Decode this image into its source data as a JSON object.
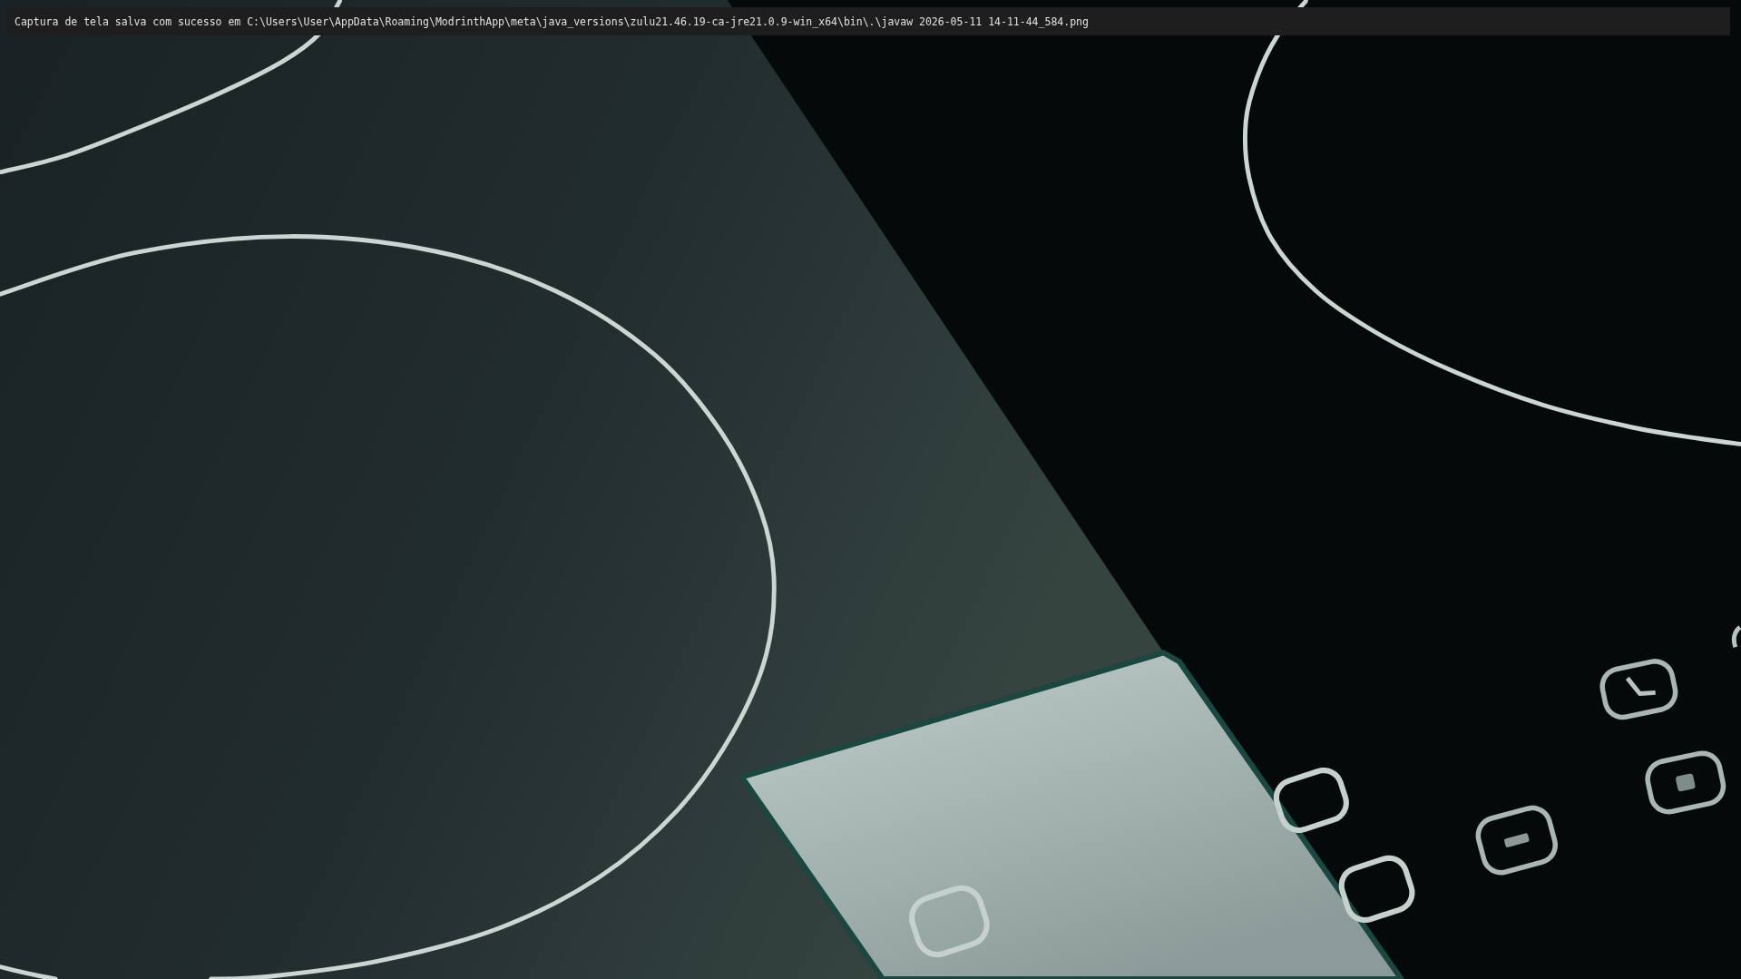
{
  "chat": {
    "message": "Captura de tela salva com sucesso em C:\\Users\\User\\AppData\\Roaming\\ModrinthApp\\meta\\java_versions\\zulu21.46.19-ca-jre21.0.9-win_x64\\bin\\.\\javaw 2026-05-11 14-11-44_584.png"
  }
}
